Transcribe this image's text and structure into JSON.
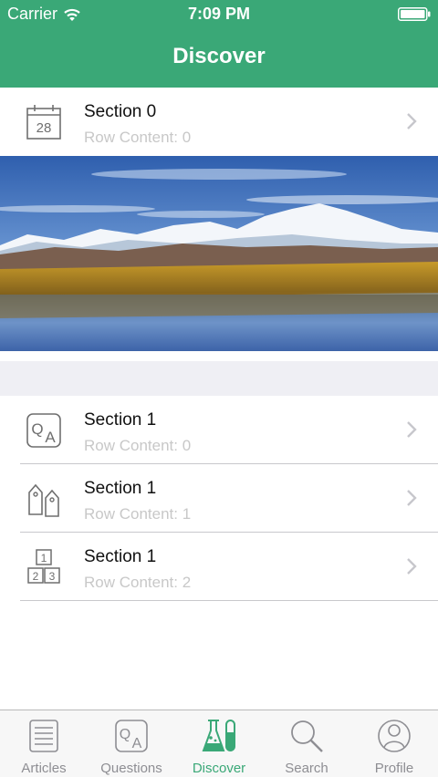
{
  "status_bar": {
    "carrier": "Carrier",
    "time": "7:09 PM"
  },
  "nav": {
    "title": "Discover"
  },
  "colors": {
    "accent": "#3aa877",
    "subtitle": "#c8c8c8",
    "tab_inactive": "#8e8e93"
  },
  "section0": {
    "rows": [
      {
        "title": "Section 0",
        "subtitle": "Row Content: 0",
        "icon": "calendar-icon",
        "calendar_day": "28"
      }
    ],
    "banner": "mountain-lake-landscape"
  },
  "section1": {
    "rows": [
      {
        "title": "Section 1",
        "subtitle": "Row Content: 0",
        "icon": "qa-icon"
      },
      {
        "title": "Section 1",
        "subtitle": "Row Content: 1",
        "icon": "tags-icon"
      },
      {
        "title": "Section 1",
        "subtitle": "Row Content: 2",
        "icon": "numbered-blocks-icon",
        "blocks": [
          "1",
          "2",
          "3"
        ]
      }
    ]
  },
  "tabbar": {
    "selected": "Discover",
    "tabs": [
      {
        "label": "Articles",
        "icon": "newspaper-icon"
      },
      {
        "label": "Questions",
        "icon": "qa-icon"
      },
      {
        "label": "Discover",
        "icon": "flask-icon"
      },
      {
        "label": "Search",
        "icon": "search-icon"
      },
      {
        "label": "Profile",
        "icon": "profile-icon"
      }
    ]
  }
}
